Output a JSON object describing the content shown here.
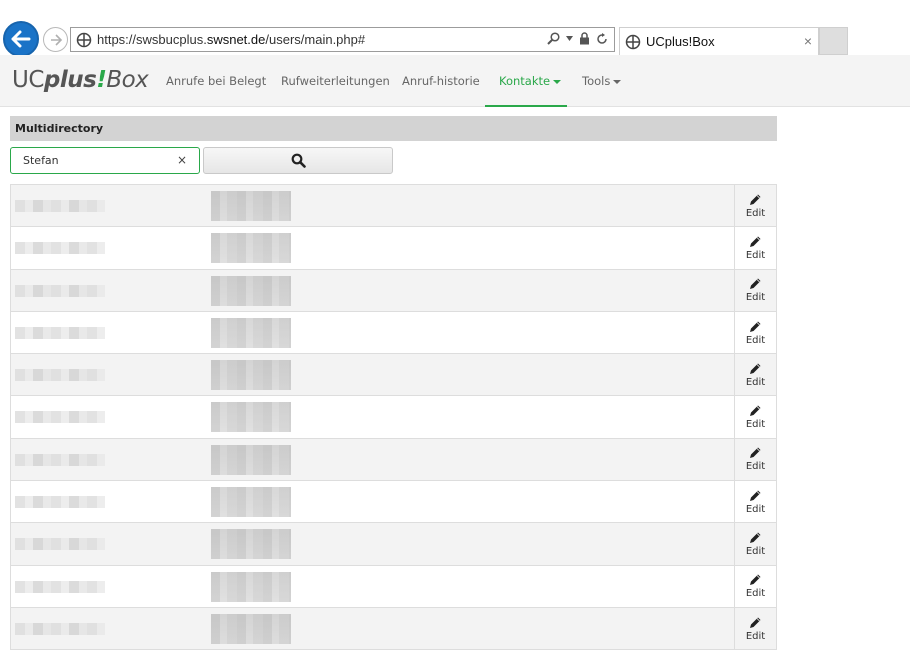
{
  "browser": {
    "url_prefix": "https://swsbucplus.",
    "url_domain": "swsnet.de",
    "url_path": "/users/main.php#",
    "tab_title": "UCplus!Box",
    "tab_close": "×"
  },
  "app": {
    "brand": {
      "uc": "UC",
      "plus": "plus",
      "bang": "!",
      "box": "Box"
    },
    "nav": [
      {
        "label": "Anrufe bei Belegt"
      },
      {
        "label": "Rufweiterleitungen"
      },
      {
        "label": "Anruf-historie"
      },
      {
        "label": "Kontakte",
        "active": true,
        "dropdown": true
      },
      {
        "label": "Tools",
        "dropdown": true
      }
    ],
    "accent_color": "#2aa84a"
  },
  "directory": {
    "heading": "Multidirectory",
    "search_value": "Stefan",
    "clear_label": "×",
    "search_icon": "magnifier-icon",
    "rows_count_visible": 11,
    "edit_label": "Edit",
    "edit_icon": "pencil-icon"
  }
}
